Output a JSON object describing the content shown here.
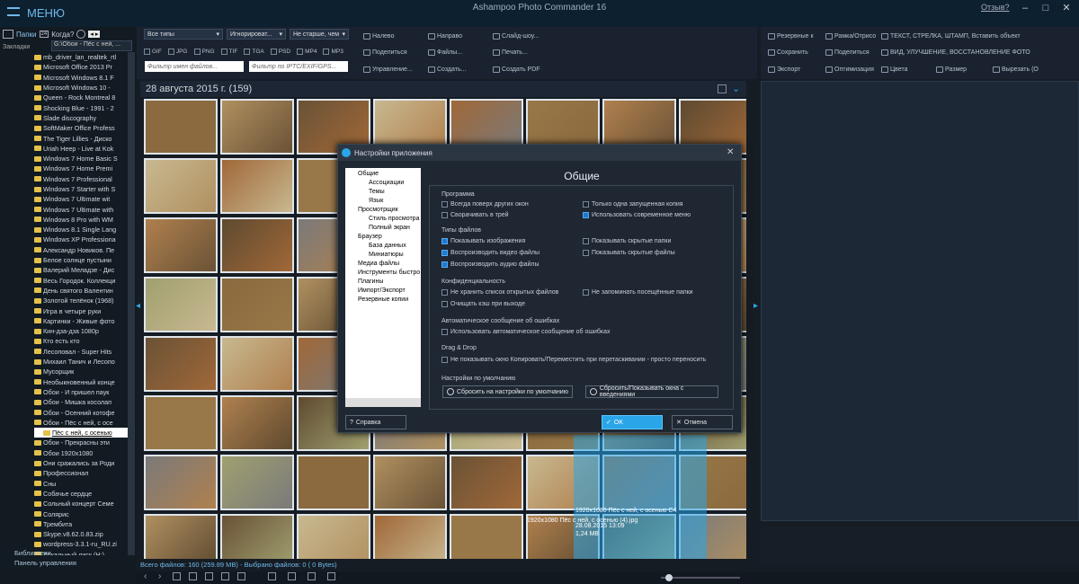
{
  "title_bar": {
    "menu": "МЕНЮ",
    "title": "Ashampoo Photo Commander 16",
    "feedback": "Отзыв?",
    "min": "–",
    "max": "□",
    "close": "✕"
  },
  "left_pane": {
    "tab_folders": "Папки",
    "day": "24",
    "when": "Когда?",
    "bookmarks": "Закладки",
    "path": "G:\\Обои - Пёс с ней, ...",
    "tree": [
      "mb_driver_lan_realtek_rtl",
      "Microsoft Office 2013 Pr",
      "Microsoft Windows 8.1 F",
      "Microsoft Windows 10 -",
      "Queen - Rock Montreal 8",
      "Shocking Blue - 1991 - 2",
      "Slade discography",
      "SoftMaker Office Profess",
      "The Tiger Lillies - Диско",
      "Uriah Heep - Live at Kok",
      "Windows 7 Home Basic S",
      "Windows 7 Home Premi",
      "Windows 7 Professional",
      "Windows 7 Starter with S",
      "Windows 7 Ultimate wit",
      "Windows 7 Ultimate with",
      "Windows 8 Pro with WM",
      "Windows 8.1 Single Lang",
      "Windows XP Professiona",
      "Александр Новиков. Пе",
      "Белое солнце пустыни",
      "Валерий Меладзе - Дис",
      "Весь Городок. Коллекци",
      "День святого Валентин",
      "Золотой телёнок (1968)",
      "Игра в четыре руки",
      "Картинки - Живые фото",
      "Кин-дза-дза 1080p",
      "Кто есть кто",
      "Лесоповал - Super Hits",
      "Михаил Танич и Лесопо",
      "Мусорщик",
      "Необыкновенный конце",
      "Обои - И пришел паук",
      "Обои - Мишка косолап",
      "Обои - Осенний котофе",
      "Обои - Пёс с ней, с осе",
      "Пёс с ней, с осенью",
      "Обои - Прекрасны эти",
      "Обои 1920x1080",
      "Они сражались за Роди",
      "Профессионал",
      "Сны",
      "Собачье сердце",
      "Сольный концерт Семе",
      "Солярис",
      "Трембита",
      "Skype.v8.62.0.83.zip",
      "wordpress-3.3.1-ru_RU.zi",
      "Локальный диск (H:)"
    ],
    "libraries": "Библиотеки",
    "control_panel": "Панель управления"
  },
  "toolbar": {
    "filter_type": "Все типы",
    "ignore": "Игнорироват...",
    "age": "Не старше, чем",
    "formats": [
      "GIF",
      "JPG",
      "PNG",
      "TIF",
      "TGA",
      "PSD",
      "MP4",
      "MP3"
    ],
    "name_filter": "Фильтр имен файлов...",
    "meta_filter": "Фильтр по IPTC/EXIF/GPS...",
    "left": "Налево",
    "right": "Направо",
    "slideshow": "Слайд-шоу...",
    "share": "Поделиться",
    "files": "Файлы...",
    "print": "Печать...",
    "manage": "Управление...",
    "create": "Создать...",
    "create_pdf": "Создать PDF"
  },
  "right_toolbar": {
    "backup": "Резервные к",
    "frame": "Рамка/Отрисо",
    "text": "ТЕКСТ, СТРЕЛКА, ШТАМП, Вставить объект",
    "save": "Сохранить",
    "share": "Поделиться",
    "view": "ВИД, УЛУЧШЕНИЕ, ВОССТАНОВЛЕНИЕ ФОТО",
    "export": "Экспорт",
    "optimize": "Оптимизация",
    "colors": "Цвета",
    "size": "Размер",
    "cut": "Вырезать (О"
  },
  "grid": {
    "date_header": "28 августа 2015 г. (159)",
    "overlay_1": "1920x1080 Пёс с ней, с осенью С4",
    "overlay_date": "28.08.2015 13:09",
    "overlay_size": "1,24 MB",
    "overlay_2": "1920x1080 Пёс с ней, с осенью (4).jpg"
  },
  "status": {
    "text": "Всего файлов: 160 (259.89 MB) - Выбрано файлов: 0 (  0 Bytes)"
  },
  "dialog": {
    "title": "Настройки приложения",
    "heading": "Общие",
    "nav": [
      {
        "label": "Общие",
        "level": 0
      },
      {
        "label": "Ассоциации",
        "level": 1
      },
      {
        "label": "Темы",
        "level": 1
      },
      {
        "label": "Язык",
        "level": 1
      },
      {
        "label": "Просмотрщик",
        "level": 0
      },
      {
        "label": "Стиль просмотра",
        "level": 1
      },
      {
        "label": "Полный экран",
        "level": 1
      },
      {
        "label": "Браузер",
        "level": 0
      },
      {
        "label": "База данных",
        "level": 1
      },
      {
        "label": "Миниатюры",
        "level": 1
      },
      {
        "label": "Медиа файлы",
        "level": 0
      },
      {
        "label": "Инструменты быстро",
        "level": 0
      },
      {
        "label": "Плагины",
        "level": 0
      },
      {
        "label": "Импорт/Экспорт",
        "level": 0
      },
      {
        "label": "Резервные копии",
        "level": 0
      }
    ],
    "groups": {
      "program": "Программа",
      "file_types": "Типы файлов",
      "privacy": "Конфиденциальность",
      "auto_report": "Автоматическое сообщение об ошибках",
      "dragdrop": "Drag & Drop",
      "defaults": "Настройки по умолчанию"
    },
    "options": {
      "always_on_top": {
        "label": "Всегда поверх других окон",
        "checked": false
      },
      "single_instance": {
        "label": "Только одна запущенная копия",
        "checked": false
      },
      "minimize_tray": {
        "label": "Сворачивать в трей",
        "checked": false
      },
      "modern_menu": {
        "label": "Использовать современное меню",
        "checked": true
      },
      "show_images": {
        "label": "Показывать изображения",
        "checked": true
      },
      "hidden_folders": {
        "label": "Показывать скрытые папки",
        "checked": false
      },
      "play_video": {
        "label": "Воспроизводить видео файлы",
        "checked": true
      },
      "hidden_files": {
        "label": "Показывать скрытые файлы",
        "checked": false
      },
      "play_audio": {
        "label": "Воспроизводить аудио файлы",
        "checked": true
      },
      "no_open_list": {
        "label": "Не хранить список открытых файлов",
        "checked": false
      },
      "no_visited": {
        "label": "Не запоминать посещённые папки",
        "checked": false
      },
      "clear_cache": {
        "label": "Очищать кэш при выходе",
        "checked": false
      },
      "use_auto_report": {
        "label": "Использовать автоматическое сообщение об ошибках",
        "checked": false
      },
      "no_copy_window": {
        "label": "Не показывать окно Копировать/Переместить при перетаскивании - просто переносить",
        "checked": false
      }
    },
    "reset_defaults": "Сбросить на настройки по умолчанию",
    "reset_windows": "Сбросить/Показывать окна с введениями",
    "help": "Справка",
    "ok": "OK",
    "cancel": "Отмена"
  }
}
